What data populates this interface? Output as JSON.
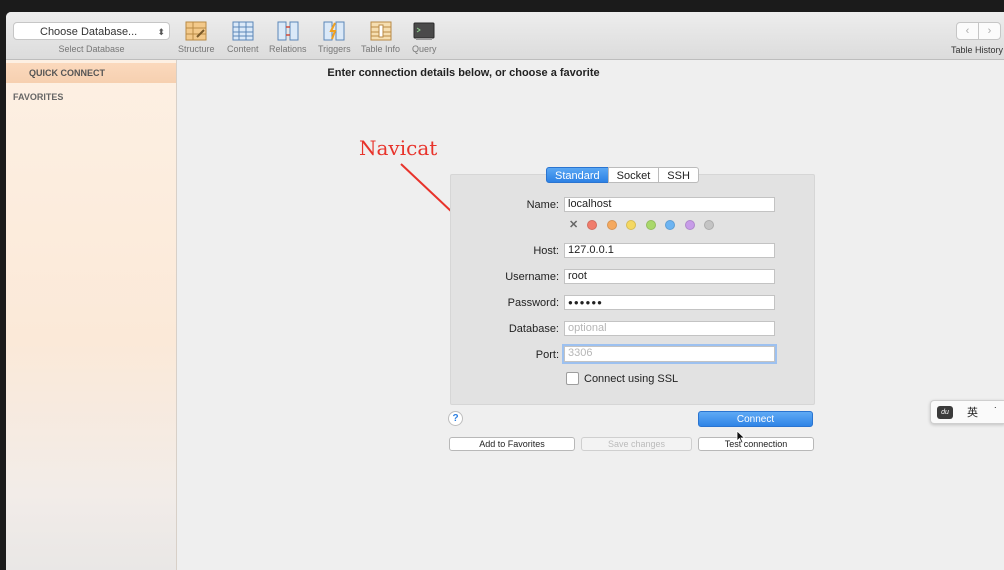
{
  "toolbar": {
    "db_select": "Choose Database...",
    "db_caption": "Select Database",
    "tools": [
      {
        "label": "Structure",
        "icon": "structure-icon"
      },
      {
        "label": "Content",
        "icon": "content-icon"
      },
      {
        "label": "Relations",
        "icon": "relations-icon"
      },
      {
        "label": "Triggers",
        "icon": "triggers-icon"
      },
      {
        "label": "Table Info",
        "icon": "table-info-icon"
      },
      {
        "label": "Query",
        "icon": "query-icon"
      }
    ],
    "back_glyph": "‹",
    "forward_glyph": "›",
    "history_label": "Table History"
  },
  "sidebar": {
    "quick_connect": "QUICK CONNECT",
    "favorites": "FAVORITES"
  },
  "main": {
    "heading": "Enter connection details below, or choose a favorite",
    "annotation": "Navicat",
    "tabs": [
      "Standard",
      "Socket",
      "SSH"
    ],
    "form": {
      "name_label": "Name:",
      "name_value": "localhost",
      "host_label": "Host:",
      "host_value": "127.0.0.1",
      "username_label": "Username:",
      "username_value": "root",
      "password_label": "Password:",
      "password_value": "●●●●●●",
      "database_label": "Database:",
      "database_placeholder": "optional",
      "port_label": "Port:",
      "port_placeholder": "3306",
      "ssl_label": "Connect using SSL"
    },
    "color_clear": "✕",
    "colors": [
      "#f07c6c",
      "#f5a95f",
      "#f4d862",
      "#a9d86b",
      "#6cb4f2",
      "#c79ce8",
      "#c4c4c4"
    ],
    "help": "?",
    "buttons": {
      "connect": "Connect",
      "add_favorites": "Add to Favorites",
      "save_changes": "Save changes",
      "test_connection": "Test connection"
    }
  },
  "ime": {
    "language": "英",
    "extra": "˙"
  }
}
